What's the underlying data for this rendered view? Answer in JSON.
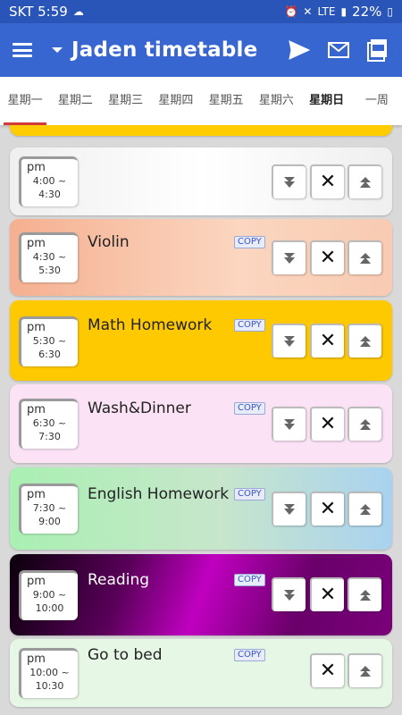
{
  "status_bar": {
    "carrier": "SKT 5:59",
    "network": "LTE",
    "battery": "22%"
  },
  "app_bar": {
    "title": "Jaden timetable"
  },
  "tabs": [
    "星期一",
    "星期二",
    "星期三",
    "星期四",
    "星期五",
    "星期六",
    "星期日",
    "一周"
  ],
  "copy_label": "COPY",
  "entries": [
    {
      "period": "pm",
      "start": "4:00 ~",
      "end": "4:30",
      "activity": ""
    },
    {
      "period": "pm",
      "start": "4:30 ~",
      "end": "5:30",
      "activity": "Violin"
    },
    {
      "period": "pm",
      "start": "5:30 ~",
      "end": "6:30",
      "activity": "Math Homework"
    },
    {
      "period": "pm",
      "start": "6:30 ~",
      "end": "7:30",
      "activity": "Wash&Dinner"
    },
    {
      "period": "pm",
      "start": "7:30 ~",
      "end": "9:00",
      "activity": "English Homework"
    },
    {
      "period": "pm",
      "start": "9:00 ~",
      "end": "10:00",
      "activity": "Reading"
    },
    {
      "period": "pm",
      "start": "10:00 ~",
      "end": "10:30",
      "activity": "Go to bed"
    }
  ],
  "colors": {
    "statusbar": "#2a55b8",
    "appbar": "#3866d0",
    "active_tab_indicator": "#d23a3a"
  }
}
